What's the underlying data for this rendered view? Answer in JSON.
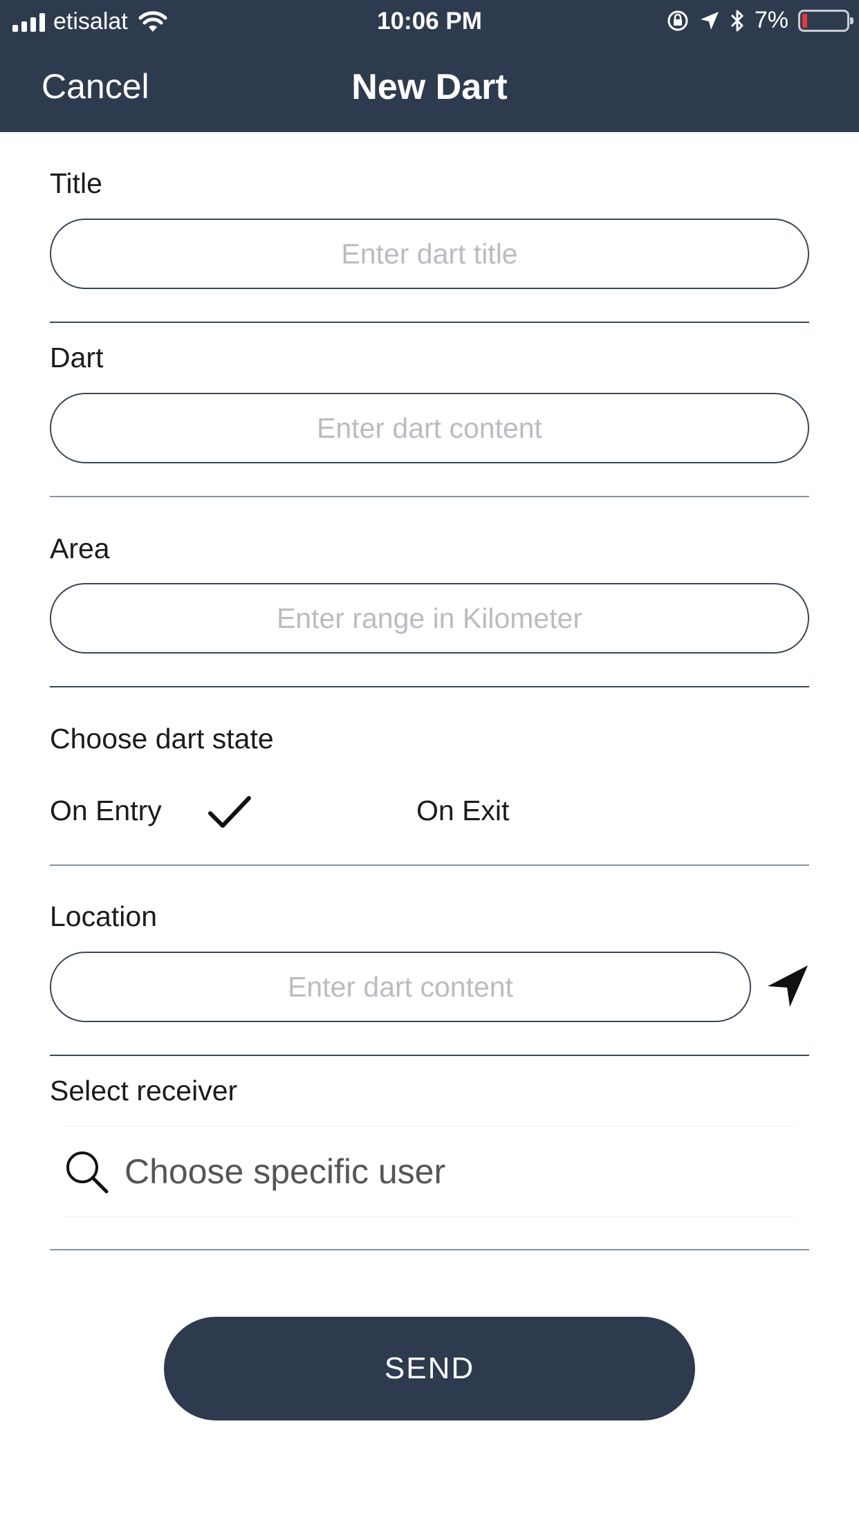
{
  "status_bar": {
    "carrier": "etisalat",
    "time": "10:06 PM",
    "battery_percent": "7%",
    "icons": [
      "signal-icon",
      "wifi-icon",
      "orientation-lock-icon",
      "location-arrow-icon",
      "bluetooth-icon",
      "battery-icon"
    ],
    "battery_level": 0.07
  },
  "nav": {
    "cancel_label": "Cancel",
    "title": "New Dart"
  },
  "form": {
    "title": {
      "label": "Title",
      "placeholder": "Enter dart title",
      "value": ""
    },
    "dart": {
      "label": "Dart",
      "placeholder": "Enter dart content",
      "value": ""
    },
    "area": {
      "label": "Area",
      "placeholder": "Enter range in Kilometer",
      "value": ""
    },
    "state": {
      "label": "Choose dart state",
      "options": [
        "On Entry",
        "On Exit"
      ],
      "selected": "On Entry"
    },
    "location": {
      "label": "Location",
      "placeholder": "Enter dart content",
      "value": ""
    },
    "receiver": {
      "label": "Select receiver",
      "search_placeholder": "Choose specific user"
    }
  },
  "actions": {
    "send_label": "SEND"
  },
  "colors": {
    "header_bg": "#2e3b4e",
    "accent": "#2e3b4e",
    "battery_low": "#e53935",
    "placeholder": "#b9bcc1"
  }
}
